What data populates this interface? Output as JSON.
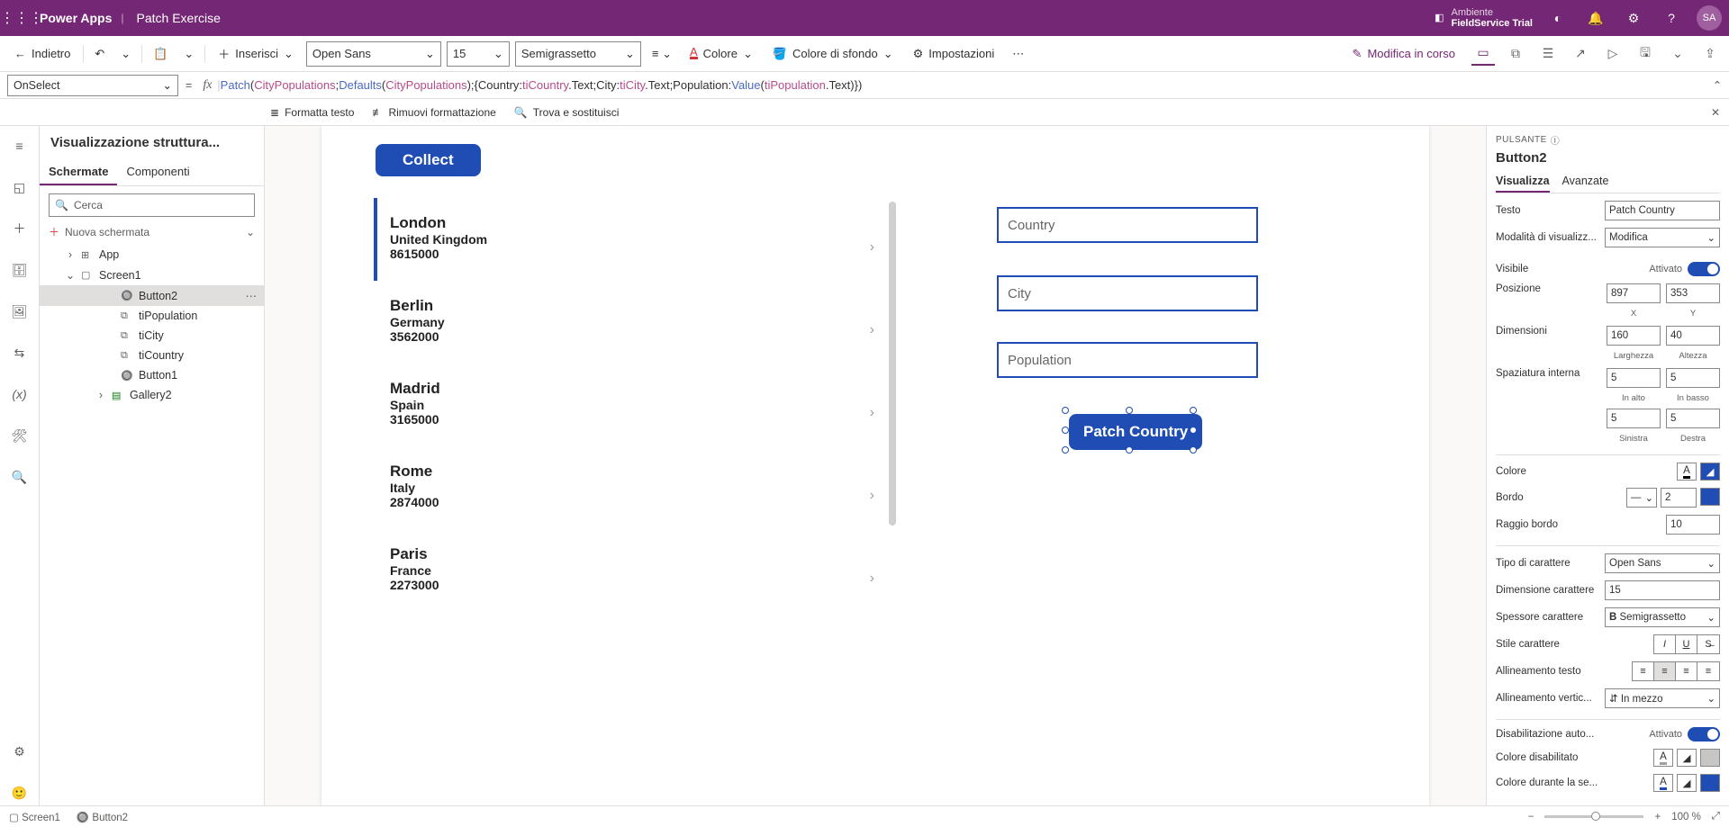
{
  "header": {
    "brand": "Power Apps",
    "appname": "Patch Exercise",
    "env_label": "Ambiente",
    "env_name": "FieldService Trial",
    "avatar": "SA"
  },
  "cmdbar": {
    "back": "Indietro",
    "insert": "Inserisci",
    "font": "Open Sans",
    "fontsize": "15",
    "weight": "Semigrassetto",
    "color": "Colore",
    "bgcolor": "Colore di sfondo",
    "settings": "Impostazioni",
    "editmode": "Modifica in corso"
  },
  "fx": {
    "prop": "OnSelect",
    "formula_plain": "Patch(CityPopulations;Defaults(CityPopulations);{Country:tiCountry.Text;City:tiCity.Text;Population:Value(tiPopulation.Text)})"
  },
  "toolbar2": {
    "format": "Formatta testo",
    "clear": "Rimuovi formattazione",
    "find": "Trova e sostituisci"
  },
  "treepane": {
    "title": "Visualizzazione struttura...",
    "tab_screens": "Schermate",
    "tab_components": "Componenti",
    "search_ph": "Cerca",
    "new_screen": "Nuova schermata",
    "items": {
      "app": "App",
      "screen1": "Screen1",
      "button2": "Button2",
      "tipop": "tiPopulation",
      "ticity": "tiCity",
      "ticountry": "tiCountry",
      "button1": "Button1",
      "gallery2": "Gallery2"
    }
  },
  "canvas": {
    "collect": "Collect",
    "inputs": {
      "country": "Country",
      "city": "City",
      "population": "Population"
    },
    "patch": "Patch Country",
    "gallery": [
      {
        "city": "London",
        "country": "United Kingdom",
        "pop": "8615000"
      },
      {
        "city": "Berlin",
        "country": "Germany",
        "pop": "3562000"
      },
      {
        "city": "Madrid",
        "country": "Spain",
        "pop": "3165000"
      },
      {
        "city": "Rome",
        "country": "Italy",
        "pop": "2874000"
      },
      {
        "city": "Paris",
        "country": "France",
        "pop": "2273000"
      }
    ]
  },
  "props": {
    "caption": "PULSANTE",
    "name": "Button2",
    "tab_display": "Visualizza",
    "tab_advanced": "Avanzate",
    "rows": {
      "text": {
        "label": "Testo",
        "value": "Patch Country"
      },
      "displaymode": {
        "label": "Modalità di visualizz...",
        "value": "Modifica"
      },
      "visible": {
        "label": "Visibile",
        "state": "Attivato"
      },
      "position": {
        "label": "Posizione",
        "x": "897",
        "y": "353",
        "xl": "X",
        "yl": "Y"
      },
      "size": {
        "label": "Dimensioni",
        "w": "160",
        "h": "40",
        "wl": "Larghezza",
        "hl": "Altezza"
      },
      "padding": {
        "label": "Spaziatura interna",
        "t": "5",
        "b": "5",
        "l": "5",
        "r": "5",
        "tl": "In alto",
        "bl": "In basso",
        "ll": "Sinistra",
        "rl": "Destra"
      },
      "color": {
        "label": "Colore"
      },
      "border": {
        "label": "Bordo",
        "val": "2"
      },
      "radius": {
        "label": "Raggio bordo",
        "val": "10"
      },
      "fontface": {
        "label": "Tipo di carattere",
        "val": "Open Sans"
      },
      "fontsize": {
        "label": "Dimensione carattere",
        "val": "15"
      },
      "fontweight": {
        "label": "Spessore carattere",
        "val": "Semigrassetto"
      },
      "fontstyle": {
        "label": "Stile carattere"
      },
      "align": {
        "label": "Allineamento testo"
      },
      "valign": {
        "label": "Allineamento vertic...",
        "val": "In mezzo"
      },
      "autodisable": {
        "label": "Disabilitazione auto...",
        "state": "Attivato"
      },
      "disabledcolor": {
        "label": "Colore disabilitato"
      },
      "hovercolor": {
        "label": "Colore durante la se..."
      }
    }
  },
  "statusbar": {
    "screen": "Screen1",
    "ctl": "Button2",
    "zoom": "100 %"
  }
}
